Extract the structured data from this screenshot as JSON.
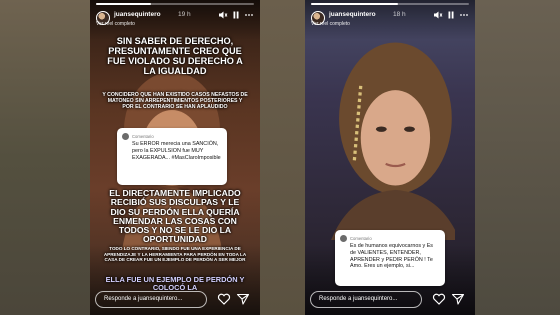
{
  "colors": {
    "panel_left_bg": "#4b3425",
    "panel_right_bg": "#2f2a3a",
    "progress_track": "#ffffff59",
    "progress_fill": "#ffffff"
  },
  "stories": [
    {
      "username": "juansequintero",
      "time": "19 h",
      "see_full": "Ver reel completo",
      "progress": 0.35,
      "text_block_1": "SIN SABER DE DERECHO, PRESUNTAMENTE CREO QUE FUE VIOLADO SU DERECHO A LA IGUALDAD",
      "text_block_2": "Y CONCIDERO QUE HAN EXISTIDO CASOS NEFASTOS DE MATONEO SIN ARREPENTIMIENTOS POSTERIORES Y POR EL CONTRARIO SE HAN APLAUDIDO",
      "comment_header": "Comentario",
      "comment_text": "Su ERROR merecia una SANCIÓN, pero la EXPULSION fue MUY EXAGERADA... #MasClaroImposible",
      "text_block_3": "EL DIRECTAMENTE IMPLICADO RECIBIÓ SUS DISCULPAS Y LE DIO SU PERDÓN ELLA QUERÍA ENMENDAR LAS COSAS CON TODOS Y NO SE LE DIO LA OPORTUNIDAD",
      "text_block_4": "TODO LO CONTRARIO, SIENDO FUE UNA EXPERIENCIA DE APRENDIZAJE Y LA HERRAMIENTA PARA PERDÓN EN TODA LA CASA DE CREAR FUE UN EJEMPLO DE PERDÓN A SER MEJOR",
      "text_block_5": "ELLA FUE UN EJEMPLO DE PERDÓN Y COLOCÓ LA",
      "reply_placeholder": "Responde a juansequintero...",
      "icons": [
        "mute-icon",
        "pause-icon",
        "more-icon",
        "heart-icon",
        "send-icon"
      ]
    },
    {
      "username": "juansequintero",
      "time": "18 h",
      "see_full": "Ver reel completo",
      "progress": 0.55,
      "comment_header": "Comentario",
      "comment_text": "Es de humanos equivocarnos y Es de VALIENTES, ENTENDER, APRENDER y PEDIR PERÓN ! Te Amo. Eres un ejemplo, si...",
      "reply_placeholder": "Responde a juansequintero...",
      "icons": [
        "mute-icon",
        "pause-icon",
        "more-icon",
        "heart-icon",
        "send-icon"
      ]
    }
  ]
}
